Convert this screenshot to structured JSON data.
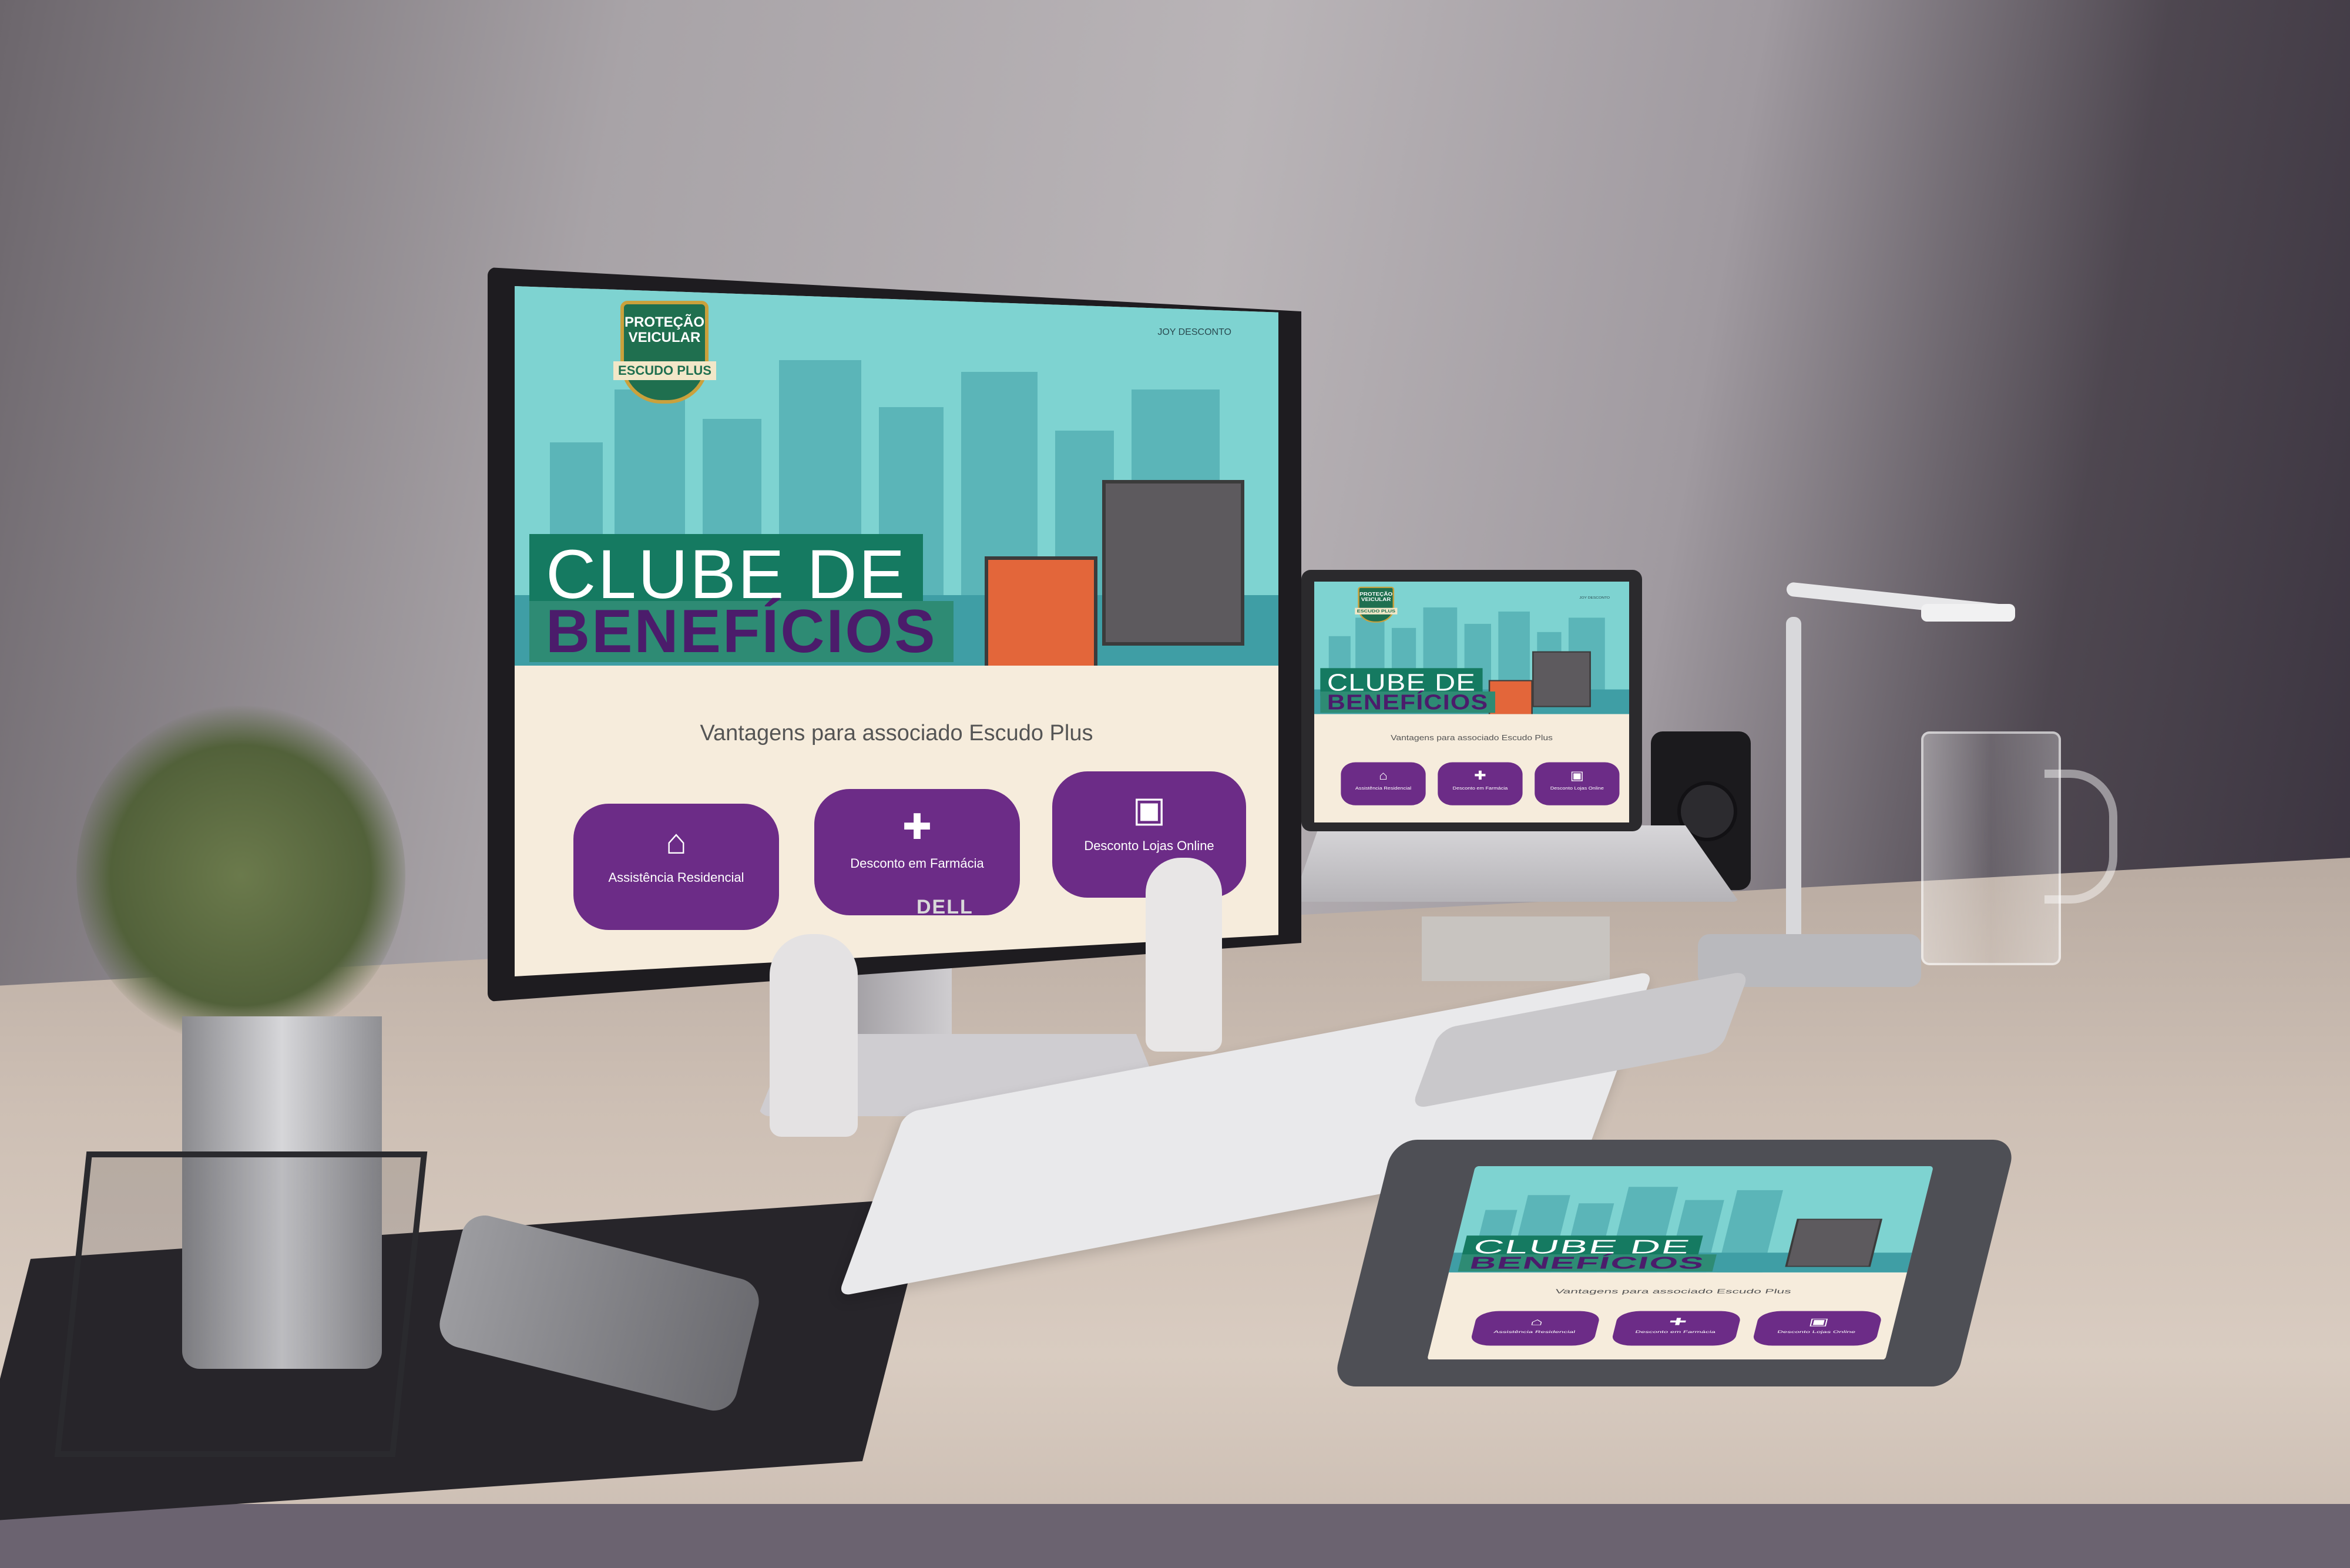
{
  "site": {
    "logo_line1": "PROTEÇÃO",
    "logo_line2": "VEICULAR",
    "logo_ribbon": "ESCUDO PLUS",
    "top_link": "JOY DESCONTO",
    "title_line1": "CLUBE DE",
    "title_line2": "BENEFÍCIOS",
    "subtitle": "Vantagens para associado Escudo Plus",
    "cards": [
      {
        "icon": "home-icon",
        "label": "Assistência Residencial"
      },
      {
        "icon": "medkit-icon",
        "label": "Desconto em Farmácia"
      },
      {
        "icon": "shopping-bag-icon",
        "label": "Desconto Lojas Online"
      }
    ]
  },
  "monitor_brand": "DELL",
  "colors": {
    "hero_sky": "#7ed3d1",
    "title_green": "#157a61",
    "title_purple": "#4b1c6b",
    "card_purple": "#6c2c87",
    "page_bg": "#f6ecdc"
  }
}
